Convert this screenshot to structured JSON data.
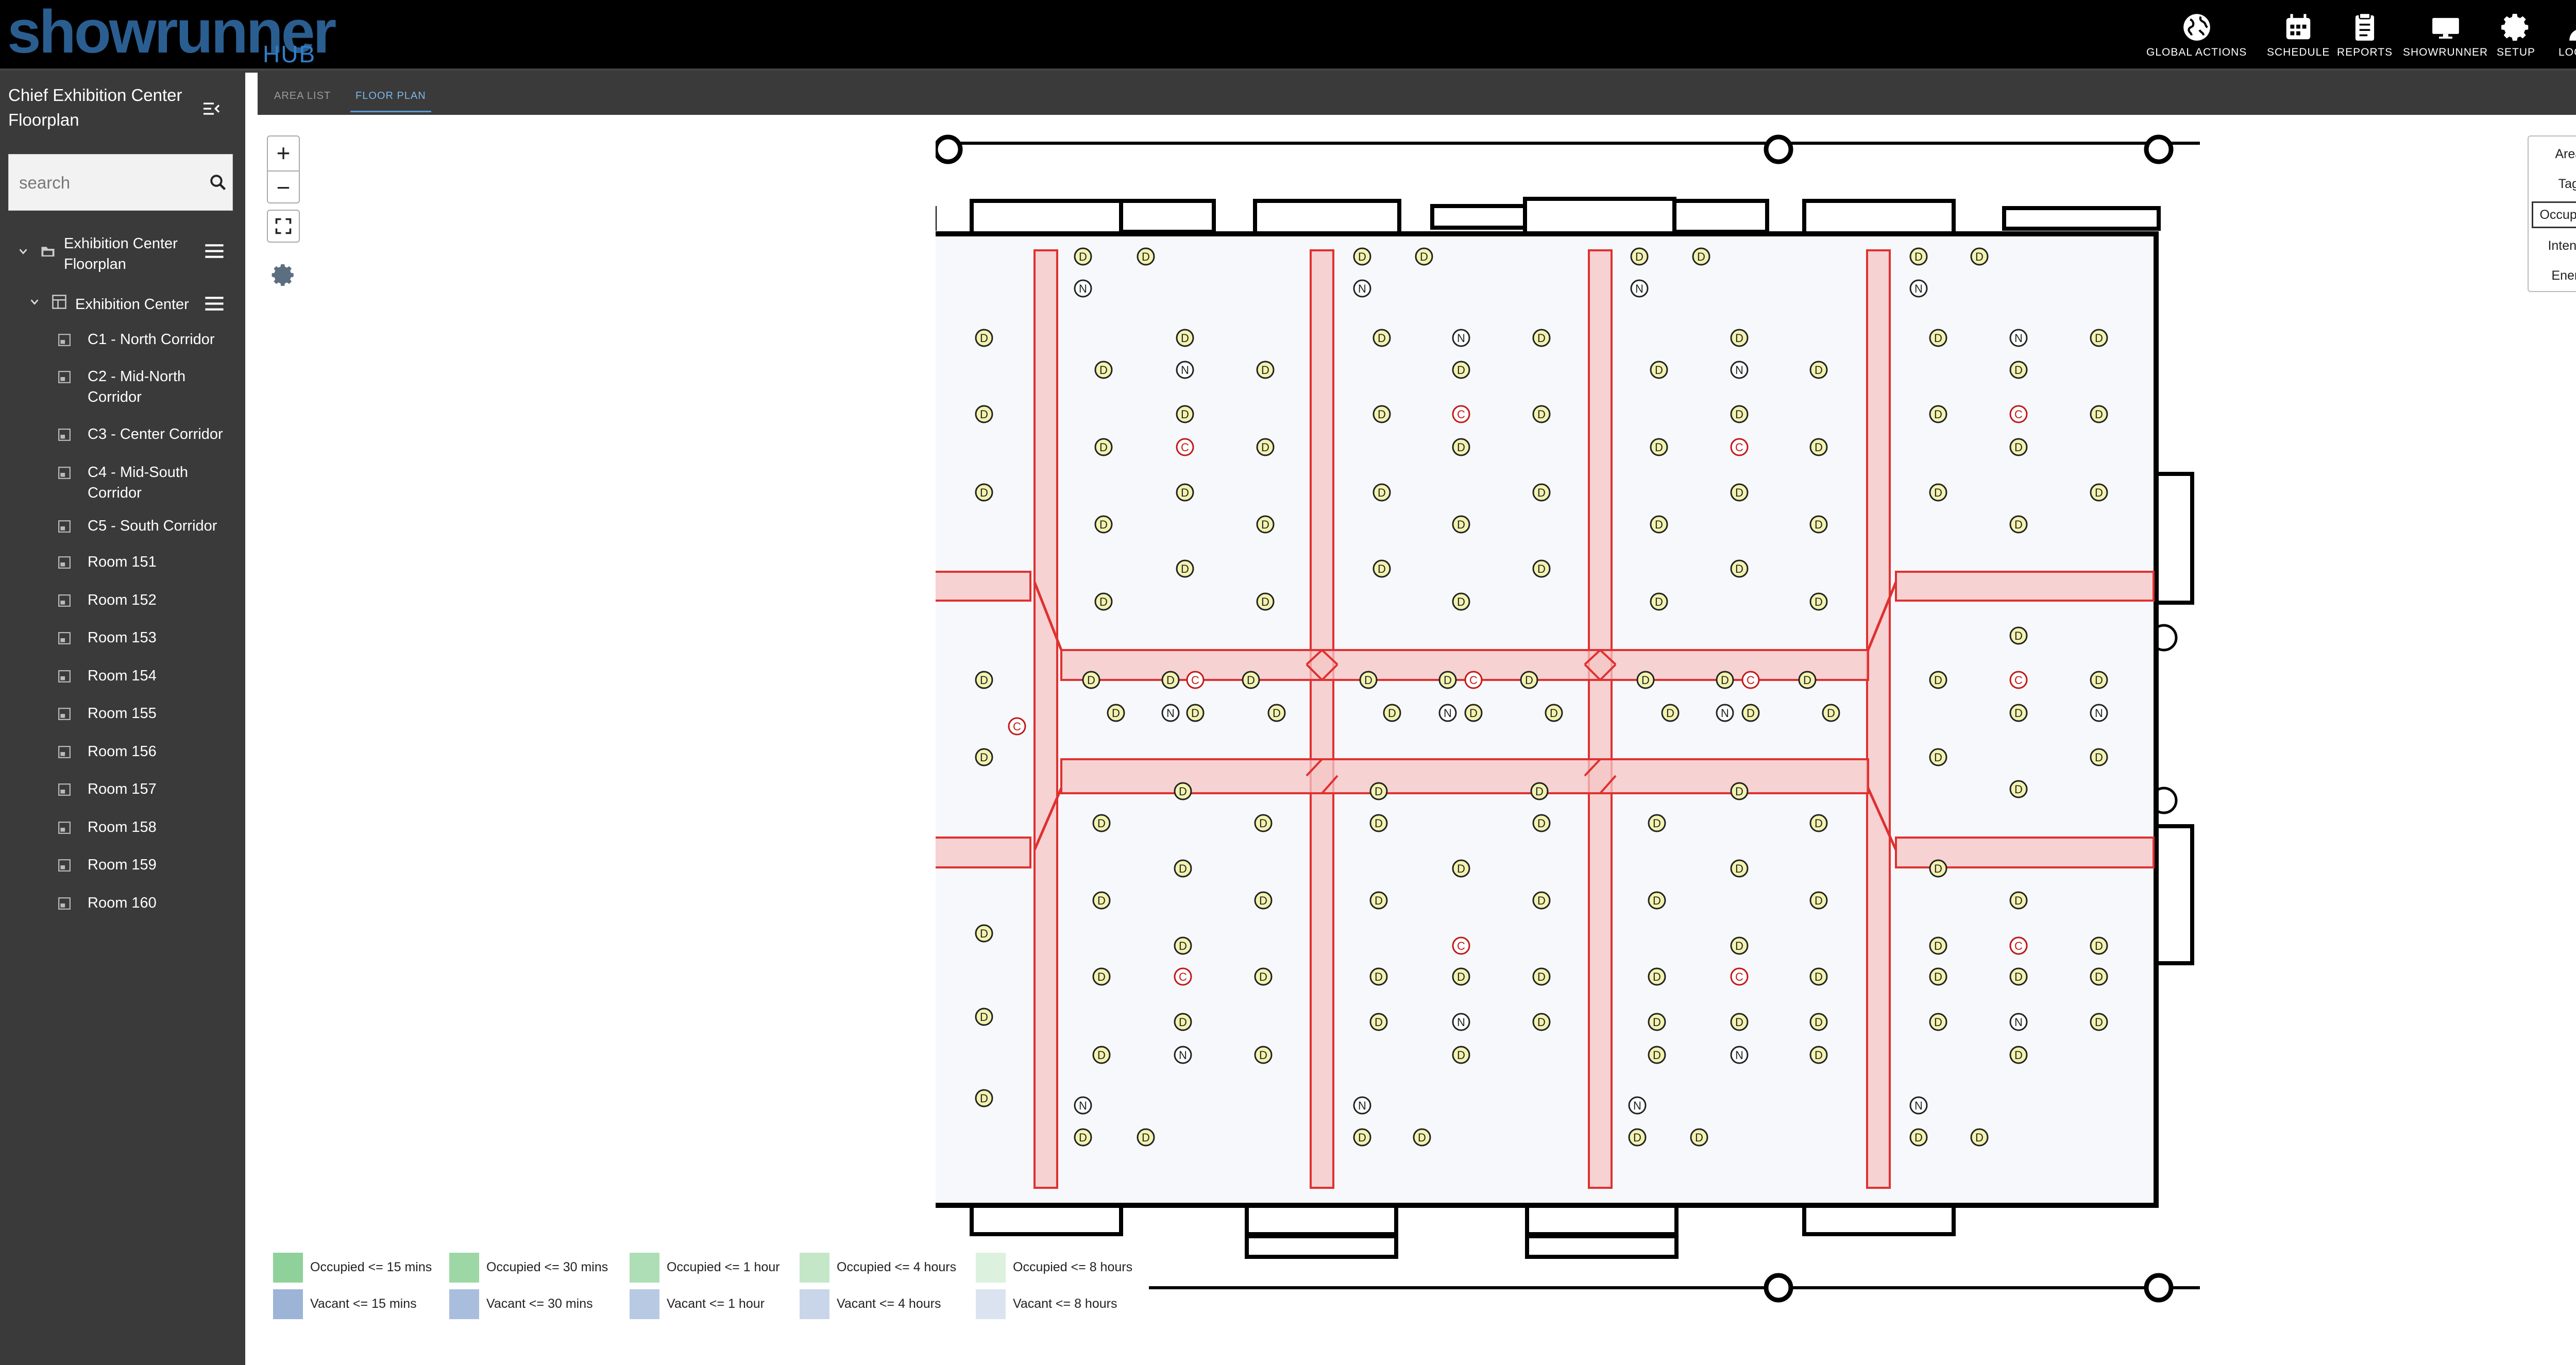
{
  "app": {
    "logo_word": "showrunner",
    "logo_sub": "HUB"
  },
  "nav": [
    {
      "label": "GLOBAL ACTIONS",
      "icon": "globe-icon"
    },
    {
      "label": "SCHEDULE",
      "icon": "calendar-icon"
    },
    {
      "label": "REPORTS",
      "icon": "clipboard-icon"
    },
    {
      "label": "SHOWRUNNER",
      "icon": "monitor-icon"
    },
    {
      "label": "SETUP",
      "icon": "gear-icon"
    },
    {
      "label": "LOGOUT",
      "icon": "user-icon"
    }
  ],
  "sidebar": {
    "title": "Chief Exhibition Center Floorplan",
    "search_placeholder": "search",
    "tree": [
      {
        "label": "Exhibition Center Floorplan"
      },
      {
        "label": "Exhibition Center"
      }
    ],
    "rooms": [
      "C1 - North Corridor",
      "C2 - Mid-North Corridor",
      "C3 - Center Corridor",
      "C4 - Mid-South Corridor",
      "C5 - South Corridor",
      "Room 151",
      "Room 152",
      "Room 153",
      "Room 154",
      "Room 155",
      "Room 156",
      "Room 157",
      "Room 158",
      "Room 159",
      "Room 160"
    ]
  },
  "tabs": [
    {
      "label": "AREA LIST",
      "active": false
    },
    {
      "label": "FLOOR PLAN",
      "active": true
    }
  ],
  "map_controls": {
    "zoom_in": "+",
    "zoom_out": "−"
  },
  "layers": [
    {
      "label": "Areas",
      "active": false
    },
    {
      "label": "Tags",
      "active": false
    },
    {
      "label": "Occupancy",
      "active": true
    },
    {
      "label": "Intensity",
      "active": false
    },
    {
      "label": "Energy",
      "active": false
    }
  ],
  "sensor_labels": {
    "daylight": "D",
    "network": "N",
    "controller": "C"
  },
  "legend": {
    "occupied": [
      {
        "label": "Occupied <= 15 mins",
        "color": "#8fd19a"
      },
      {
        "label": "Occupied <= 30 mins",
        "color": "#9ed7a6"
      },
      {
        "label": "Occupied <= 1 hour",
        "color": "#aedeb5"
      },
      {
        "label": "Occupied <= 4 hours",
        "color": "#c4e7c8"
      },
      {
        "label": "Occupied <= 8 hours",
        "color": "#dcf1de"
      }
    ],
    "vacant": [
      {
        "label": "Vacant <= 15 mins",
        "color": "#9db4d6"
      },
      {
        "label": "Vacant <= 30 mins",
        "color": "#a9bedd"
      },
      {
        "label": "Vacant <= 1 hour",
        "color": "#b7c9e3"
      },
      {
        "label": "Vacant <= 4 hours",
        "color": "#c9d6ea"
      },
      {
        "label": "Vacant <= 8 hours",
        "color": "#dbe3f0"
      }
    ]
  },
  "colors": {
    "corridor_fill": "#f5c6c6",
    "corridor_stroke": "#e03030",
    "room_fill": "#f6f8fb",
    "sensor_fill": "#f3f3b0"
  }
}
